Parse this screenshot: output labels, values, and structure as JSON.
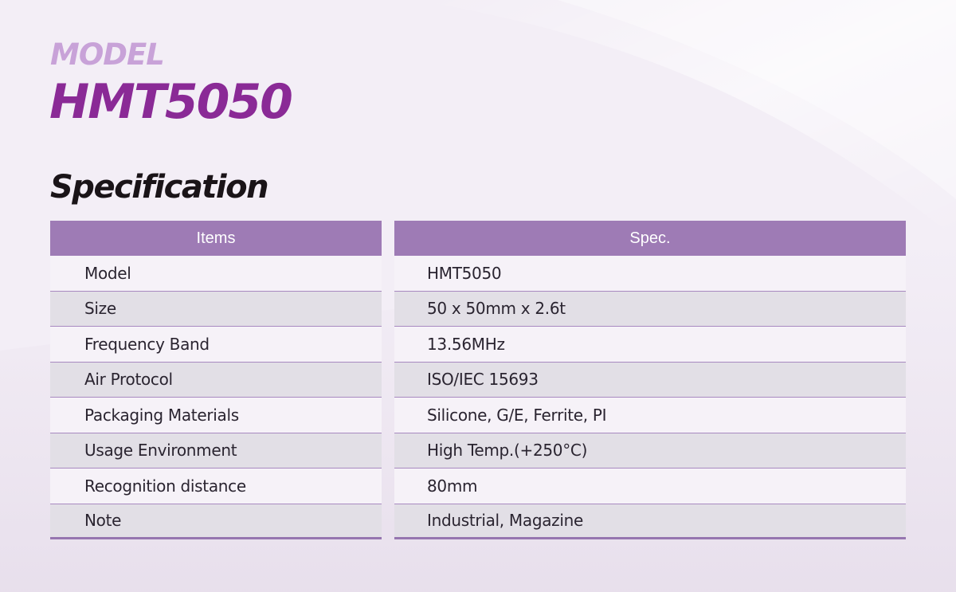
{
  "header": {
    "model_label": "MODEL",
    "model_name": "HMT5050",
    "spec_title": "Specification"
  },
  "table": {
    "headers": {
      "items": "Items",
      "spec": "Spec."
    },
    "rows": [
      {
        "item": "Model",
        "spec": "HMT5050"
      },
      {
        "item": "Size",
        "spec": "50 x 50mm x 2.6t"
      },
      {
        "item": "Frequency Band",
        "spec": "13.56MHz"
      },
      {
        "item": "Air Protocol",
        "spec": "ISO/IEC 15693"
      },
      {
        "item": "Packaging Materials",
        "spec": "Silicone, G/E, Ferrite, PI"
      },
      {
        "item": "Usage Environment",
        "spec": "High Temp.(+250°C)"
      },
      {
        "item": "Recognition distance",
        "spec": "80mm"
      },
      {
        "item": "Note",
        "spec": "Industrial, Magazine"
      }
    ]
  },
  "colors": {
    "accent_purple": "#8a2a96",
    "light_purple": "#c8a2d8",
    "header_bg": "#9e7bb5",
    "background": "#f3eef6"
  }
}
